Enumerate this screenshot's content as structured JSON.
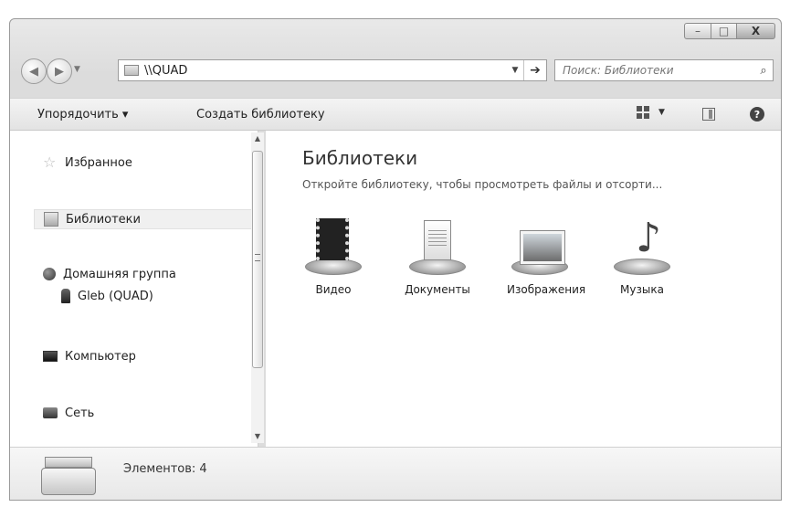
{
  "window": {
    "caption": {
      "minimize": "–",
      "maximize": "□",
      "close": "X"
    }
  },
  "address": {
    "path": "\\\\QUAD",
    "go_glyph": "➔"
  },
  "search": {
    "placeholder": "Поиск: Библиотеки"
  },
  "toolbar": {
    "organize_label": "Упорядочить ▾",
    "create_library_label": "Создать библиотеку"
  },
  "nav": {
    "favorites": "Избранное",
    "libraries": "Библиотеки",
    "homegroup": "Домашняя группа",
    "homegroup_user": "Gleb (QUAD)",
    "computer": "Компьютер",
    "network": "Сеть"
  },
  "content": {
    "title": "Библиотеки",
    "subtitle": "Откройте библиотеку, чтобы просмотреть файлы и отсорти...",
    "libraries": [
      {
        "label": "Видео",
        "icon": "video-library-icon"
      },
      {
        "label": "Документы",
        "icon": "documents-library-icon"
      },
      {
        "label": "Изображения",
        "icon": "pictures-library-icon"
      },
      {
        "label": "Музыка",
        "icon": "music-library-icon"
      }
    ]
  },
  "status": {
    "text": "Элементов: 4"
  }
}
